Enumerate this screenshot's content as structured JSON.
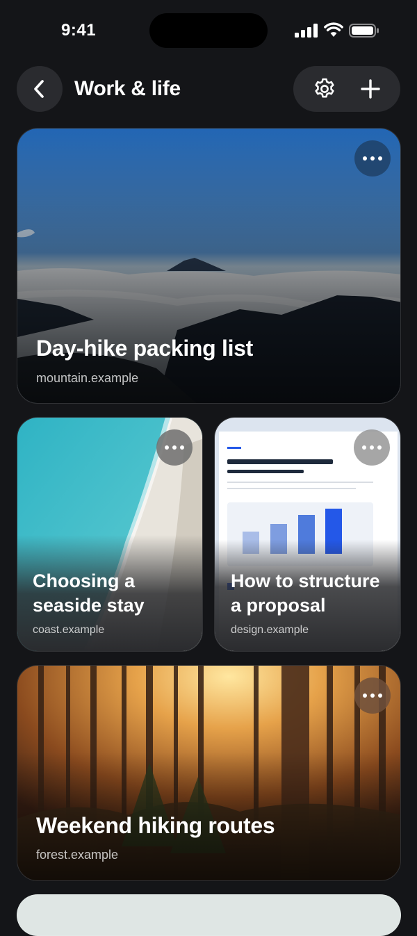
{
  "status_bar": {
    "time": "9:41"
  },
  "header": {
    "title": "Work & life"
  },
  "cards": [
    {
      "title": "Day-hike packing list",
      "source": "mountain.example"
    },
    {
      "title": "Choosing a seaside stay",
      "source": "coast.example"
    },
    {
      "title": "How to structure a proposal",
      "source": "design.example"
    },
    {
      "title": "Weekend hiking routes",
      "source": "forest.example"
    }
  ],
  "colors": {
    "background": "#141518",
    "button_bg": "#2a2b2f",
    "accent_bar": "#2458e8"
  },
  "icons": [
    "back-chevron-icon",
    "gear-icon",
    "plus-icon",
    "more-dots-icon",
    "signal-icon",
    "wifi-icon",
    "battery-icon"
  ]
}
